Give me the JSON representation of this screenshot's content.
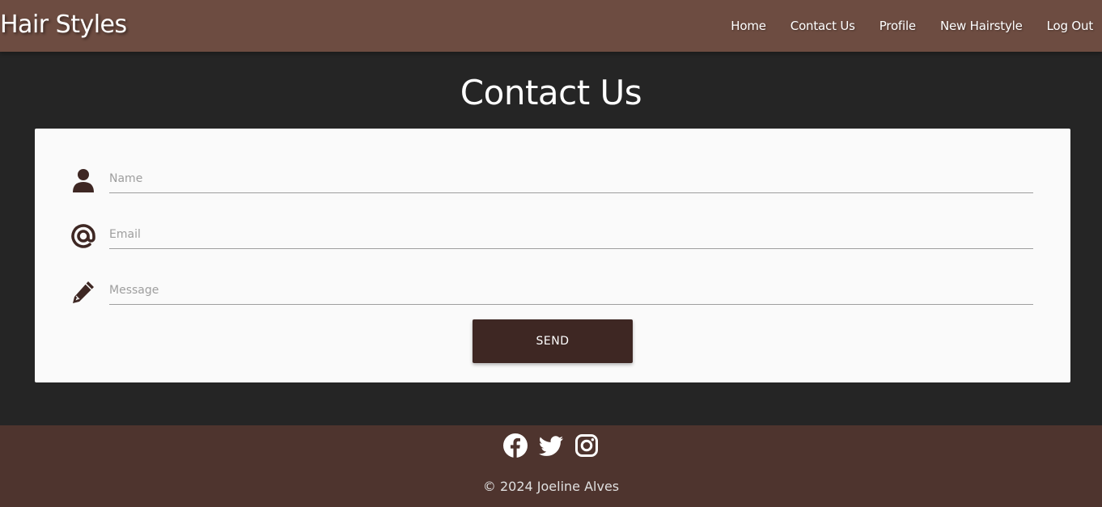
{
  "navbar": {
    "brand": "Hair Styles",
    "links": [
      "Home",
      "Contact Us",
      "Profile",
      "New Hairstyle",
      "Log Out"
    ]
  },
  "page": {
    "title": "Contact Us"
  },
  "form": {
    "name_placeholder": "Name",
    "email_placeholder": "Email",
    "message_placeholder": "Message",
    "send_label": "SEND"
  },
  "footer": {
    "social_icons": [
      "facebook-icon",
      "twitter-icon",
      "instagram-icon"
    ],
    "copyright": "© 2024 Joeline Alves"
  },
  "colors": {
    "navbar": "#6d4c41",
    "background": "#252525",
    "card": "#fafafa",
    "button": "#3e2723",
    "footer": "#4e342e",
    "icon": "#3e2723"
  }
}
